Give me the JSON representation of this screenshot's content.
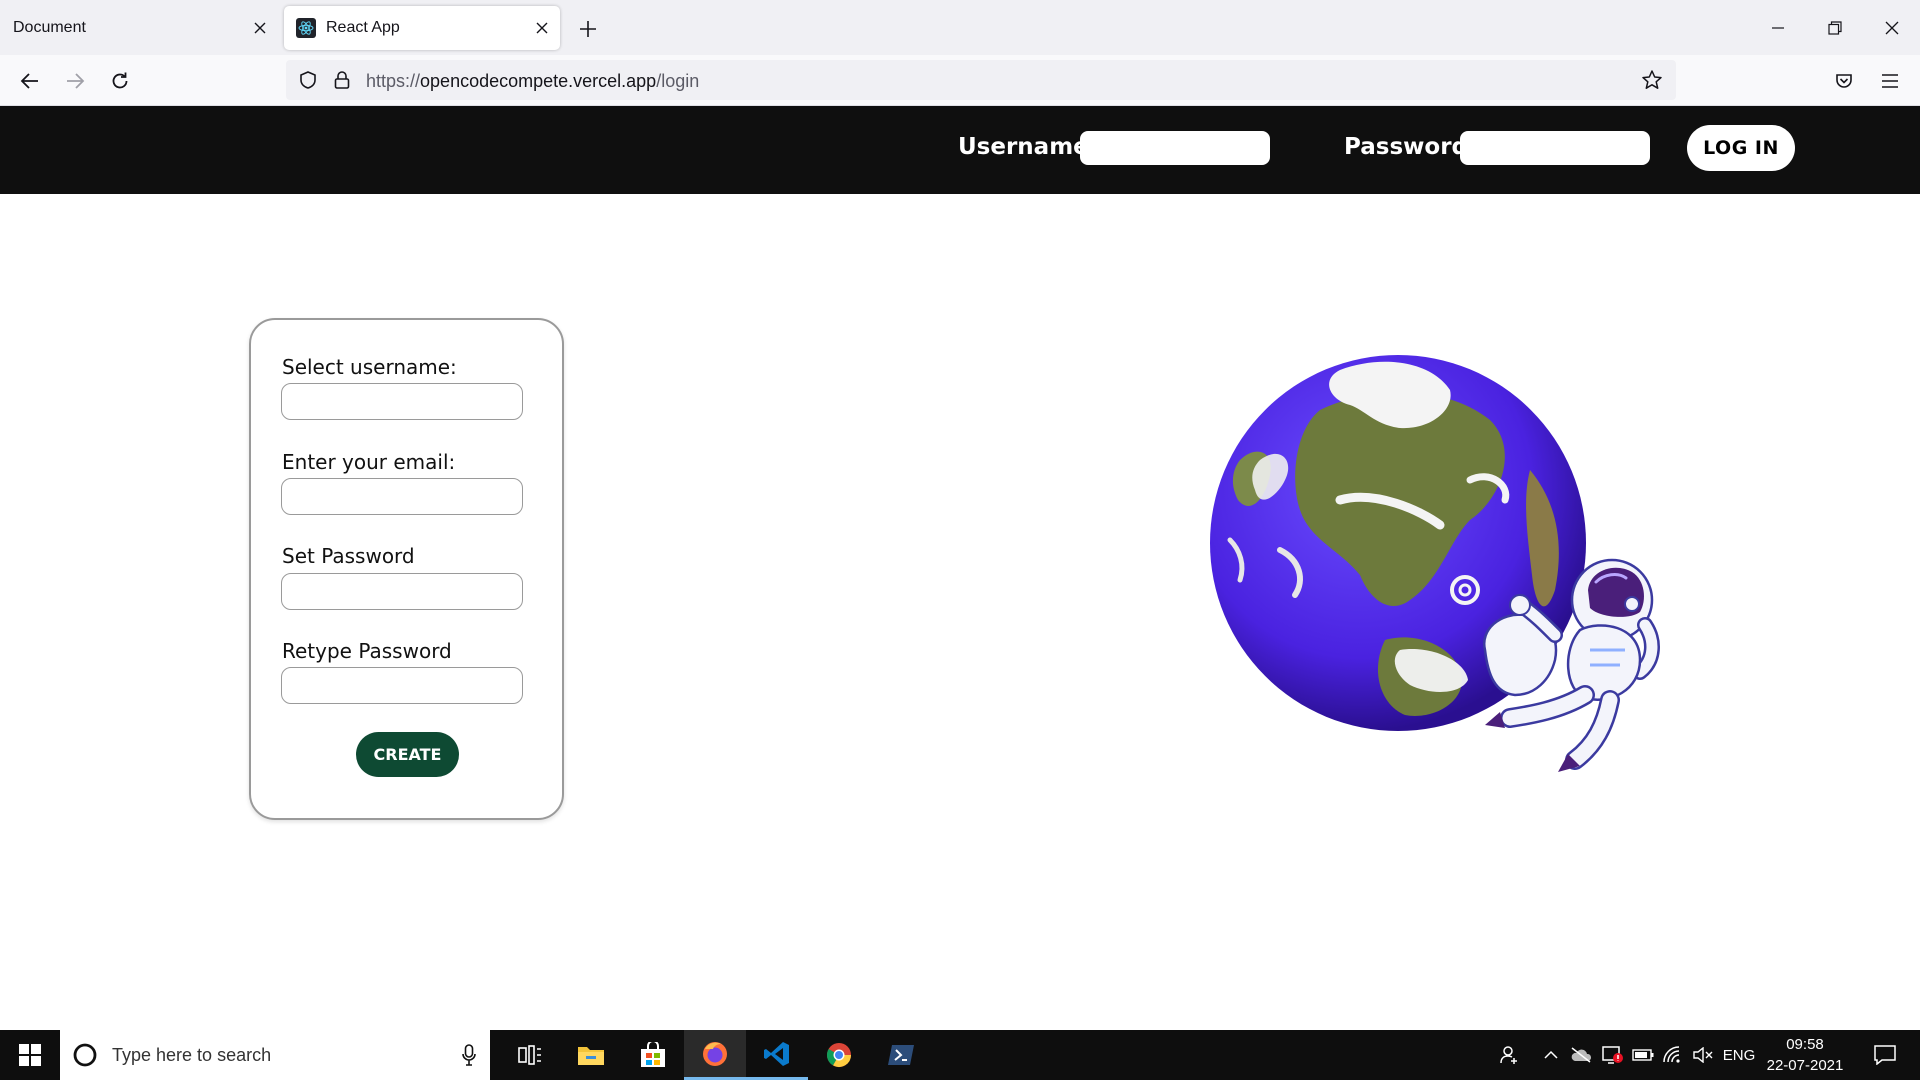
{
  "browser": {
    "tabs": [
      {
        "label": "Document",
        "active": false
      },
      {
        "label": "React App",
        "active": true,
        "favicon": "react-icon"
      }
    ],
    "url_prefix": "https://",
    "url_host": "opencodecompete.vercel.app",
    "url_path": "/login"
  },
  "header": {
    "username_label": "Username",
    "password_label": "Password",
    "username_value": "",
    "password_value": "",
    "login_label": "LOG IN"
  },
  "signup": {
    "fields": [
      {
        "label": "Select username:",
        "value": ""
      },
      {
        "label": "Enter your email:",
        "value": ""
      },
      {
        "label": "Set Password",
        "value": ""
      },
      {
        "label": "Retype Password",
        "value": ""
      }
    ],
    "create_label": "CREATE",
    "create_color": "#0e4a33"
  },
  "illustration": {
    "subject": "earth-globe-with-astronaut"
  },
  "taskbar": {
    "search_placeholder": "Type here to search",
    "language": "ENG",
    "time": "09:58",
    "date": "22-07-2021",
    "pinned": [
      "task-view-icon",
      "file-explorer-icon",
      "store-icon",
      "firefox-icon",
      "vscode-icon",
      "chrome-icon",
      "terminal-icon"
    ]
  }
}
